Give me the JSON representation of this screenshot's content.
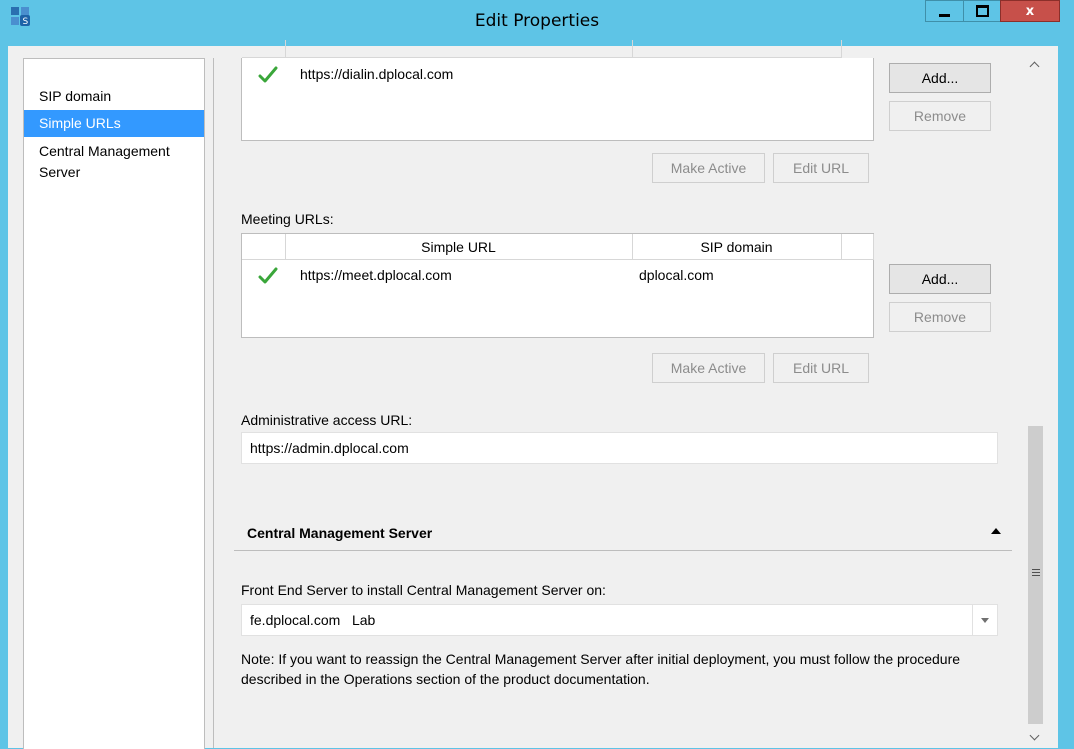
{
  "window": {
    "title": "Edit Properties",
    "close_glyph": "x",
    "icon": "topology-builder-icon"
  },
  "nav": {
    "items": [
      {
        "label": "SIP domain"
      },
      {
        "label": "Simple URLs"
      },
      {
        "label": "Central Management Server"
      }
    ],
    "selected_index": 1
  },
  "dialin": {
    "rows": [
      {
        "url": "https://dialin.dplocal.com",
        "active": true
      }
    ],
    "add_label": "Add...",
    "remove_label": "Remove",
    "make_active_label": "Make Active",
    "edit_url_label": "Edit URL"
  },
  "meeting": {
    "label": "Meeting URLs:",
    "columns": [
      "Simple URL",
      "SIP domain"
    ],
    "rows": [
      {
        "url": "https://meet.dplocal.com",
        "domain": "dplocal.com",
        "active": true
      }
    ],
    "add_label": "Add...",
    "remove_label": "Remove",
    "make_active_label": "Make Active",
    "edit_url_label": "Edit URL"
  },
  "admin": {
    "label": "Administrative access URL:",
    "value": "https://admin.dplocal.com"
  },
  "cms": {
    "section_title": "Central Management Server",
    "front_end_label": "Front End Server to install Central Management Server on:",
    "front_end_value": "fe.dplocal.com   Lab",
    "note": "Note: If you want to reassign the Central Management Server after initial deployment, you must follow the procedure described in the Operations section of the product documentation."
  },
  "colors": {
    "titlebar": "#5ec4e6",
    "close_button": "#c7504a",
    "selection": "#3399ff",
    "checkmark": "#3aa63a"
  }
}
